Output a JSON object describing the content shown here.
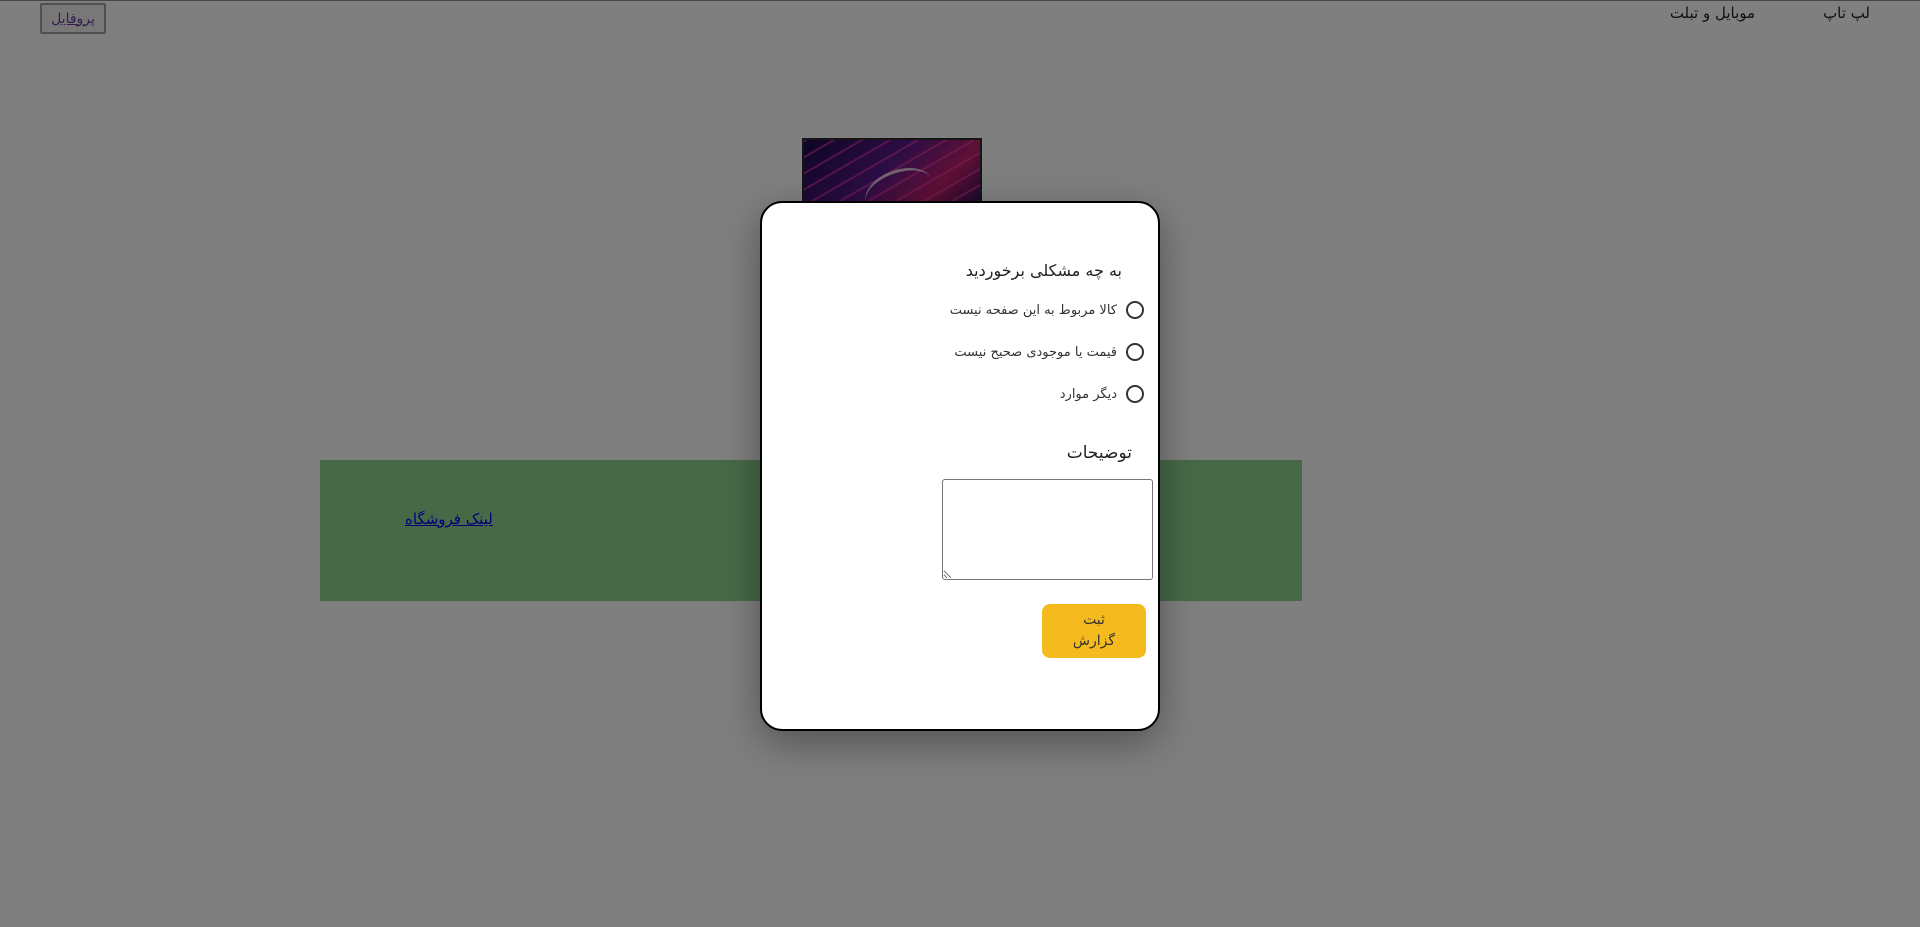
{
  "header": {
    "profile_label": "پروفایل",
    "nav": [
      {
        "label": "موبایل و تبلت"
      },
      {
        "label": "لپ تاپ"
      }
    ]
  },
  "main": {
    "store_link_label": "لینک فروشگاه"
  },
  "report_modal": {
    "question": "به چه مشکلی برخوردید",
    "options": [
      {
        "label": "کالا مربوط به این صفحه نیست",
        "selected": false
      },
      {
        "label": "قیمت یا موجودی صحیح نیست",
        "selected": false
      },
      {
        "label": "دیگر موارد",
        "selected": false
      }
    ],
    "description_label": "توضیحات",
    "description_value": "",
    "submit_label": "ثبت گزارش"
  },
  "colors": {
    "overlay": "rgba(0,0,0,0.5)",
    "submit_button": "#f5bb1e",
    "store_banner": "#8fd28f",
    "link": "#0000ee"
  }
}
